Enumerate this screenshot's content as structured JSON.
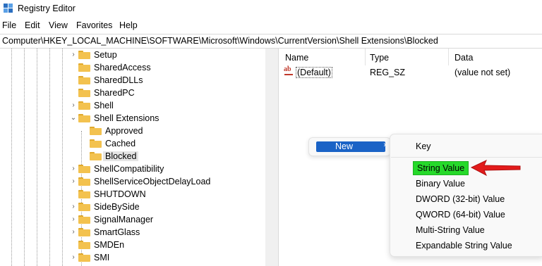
{
  "window": {
    "title": "Registry Editor"
  },
  "menu": [
    "File",
    "Edit",
    "View",
    "Favorites",
    "Help"
  ],
  "address": "Computer\\HKEY_LOCAL_MACHINE\\SOFTWARE\\Microsoft\\Windows\\CurrentVersion\\Shell Extensions\\Blocked",
  "tree": [
    {
      "label": "Setup",
      "chevron": ">",
      "level": 0
    },
    {
      "label": "SharedAccess",
      "chevron": "",
      "level": 0
    },
    {
      "label": "SharedDLLs",
      "chevron": "",
      "level": 0
    },
    {
      "label": "SharedPC",
      "chevron": "",
      "level": 0
    },
    {
      "label": "Shell",
      "chevron": ">",
      "level": 0
    },
    {
      "label": "Shell Extensions",
      "chevron": "v",
      "level": 0
    },
    {
      "label": "Approved",
      "chevron": "",
      "level": 1
    },
    {
      "label": "Cached",
      "chevron": "",
      "level": 1
    },
    {
      "label": "Blocked",
      "chevron": "",
      "level": 1,
      "selected": true
    },
    {
      "label": "ShellCompatibility",
      "chevron": ">",
      "level": 0
    },
    {
      "label": "ShellServiceObjectDelayLoad",
      "chevron": ">",
      "level": 0
    },
    {
      "label": "SHUTDOWN",
      "chevron": "",
      "level": 0
    },
    {
      "label": "SideBySide",
      "chevron": ">",
      "level": 0
    },
    {
      "label": "SignalManager",
      "chevron": ">",
      "level": 0
    },
    {
      "label": "SmartGlass",
      "chevron": ">",
      "level": 0
    },
    {
      "label": "SMDEn",
      "chevron": "",
      "level": 0
    },
    {
      "label": "SMI",
      "chevron": ">",
      "level": 0
    }
  ],
  "columns": {
    "name": "Name",
    "type": "Type",
    "data": "Data"
  },
  "values": [
    {
      "name": "(Default)",
      "type": "REG_SZ",
      "data": "(value not set)",
      "icon": "string-value-icon"
    }
  ],
  "context_menu": {
    "new_label": "New",
    "arrow": "›"
  },
  "submenu": {
    "key": "Key",
    "items": [
      "String Value",
      "Binary Value",
      "DWORD (32-bit) Value",
      "QWORD (64-bit) Value",
      "Multi-String Value",
      "Expandable String Value"
    ]
  },
  "colors": {
    "highlight": "#1a63c6",
    "string_value_highlight": "#26d92a",
    "annotation_arrow": "#e31b1b",
    "folder": "#f3c24f"
  }
}
